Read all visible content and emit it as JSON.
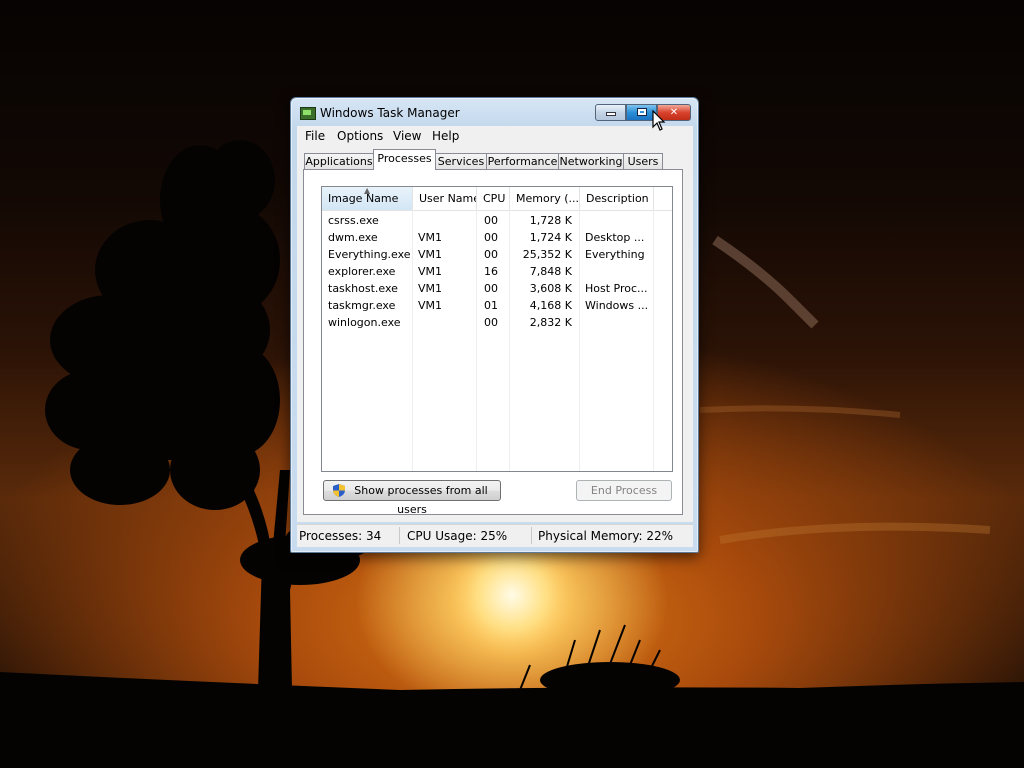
{
  "window": {
    "title": "Windows Task Manager",
    "caption_buttons": [
      "minimize",
      "maximize",
      "close"
    ]
  },
  "menu": [
    "File",
    "Options",
    "View",
    "Help"
  ],
  "tabs": [
    {
      "label": "Applications",
      "active": false
    },
    {
      "label": "Processes",
      "active": true
    },
    {
      "label": "Services",
      "active": false
    },
    {
      "label": "Performance",
      "active": false
    },
    {
      "label": "Networking",
      "active": false
    },
    {
      "label": "Users",
      "active": false
    }
  ],
  "processes": {
    "columns": [
      "Image Name",
      "User Name",
      "CPU",
      "Memory (...",
      "Description"
    ],
    "sorted_column": "Image Name",
    "rows": [
      {
        "name": "csrss.exe",
        "user": "",
        "cpu": "00",
        "memory": "1,728 K",
        "description": ""
      },
      {
        "name": "dwm.exe",
        "user": "VM1",
        "cpu": "00",
        "memory": "1,724 K",
        "description": "Desktop ..."
      },
      {
        "name": "Everything.exe",
        "user": "VM1",
        "cpu": "00",
        "memory": "25,352 K",
        "description": "Everything"
      },
      {
        "name": "explorer.exe",
        "user": "VM1",
        "cpu": "16",
        "memory": "7,848 K",
        "description": ""
      },
      {
        "name": "taskhost.exe",
        "user": "VM1",
        "cpu": "00",
        "memory": "3,608 K",
        "description": "Host Proc..."
      },
      {
        "name": "taskmgr.exe",
        "user": "VM1",
        "cpu": "01",
        "memory": "4,168 K",
        "description": "Windows ..."
      },
      {
        "name": "winlogon.exe",
        "user": "",
        "cpu": "00",
        "memory": "2,832 K",
        "description": ""
      }
    ]
  },
  "buttons": {
    "show_all": "Show processes from all users",
    "end_process": "End Process"
  },
  "status": {
    "processes": "Processes: 34",
    "cpu": "CPU Usage: 25%",
    "memory": "Physical Memory: 22%"
  },
  "colors": {
    "close_button": "#d8432d",
    "maximize_button": "#2a8fd8",
    "selected_header": "#d3e6f5"
  }
}
